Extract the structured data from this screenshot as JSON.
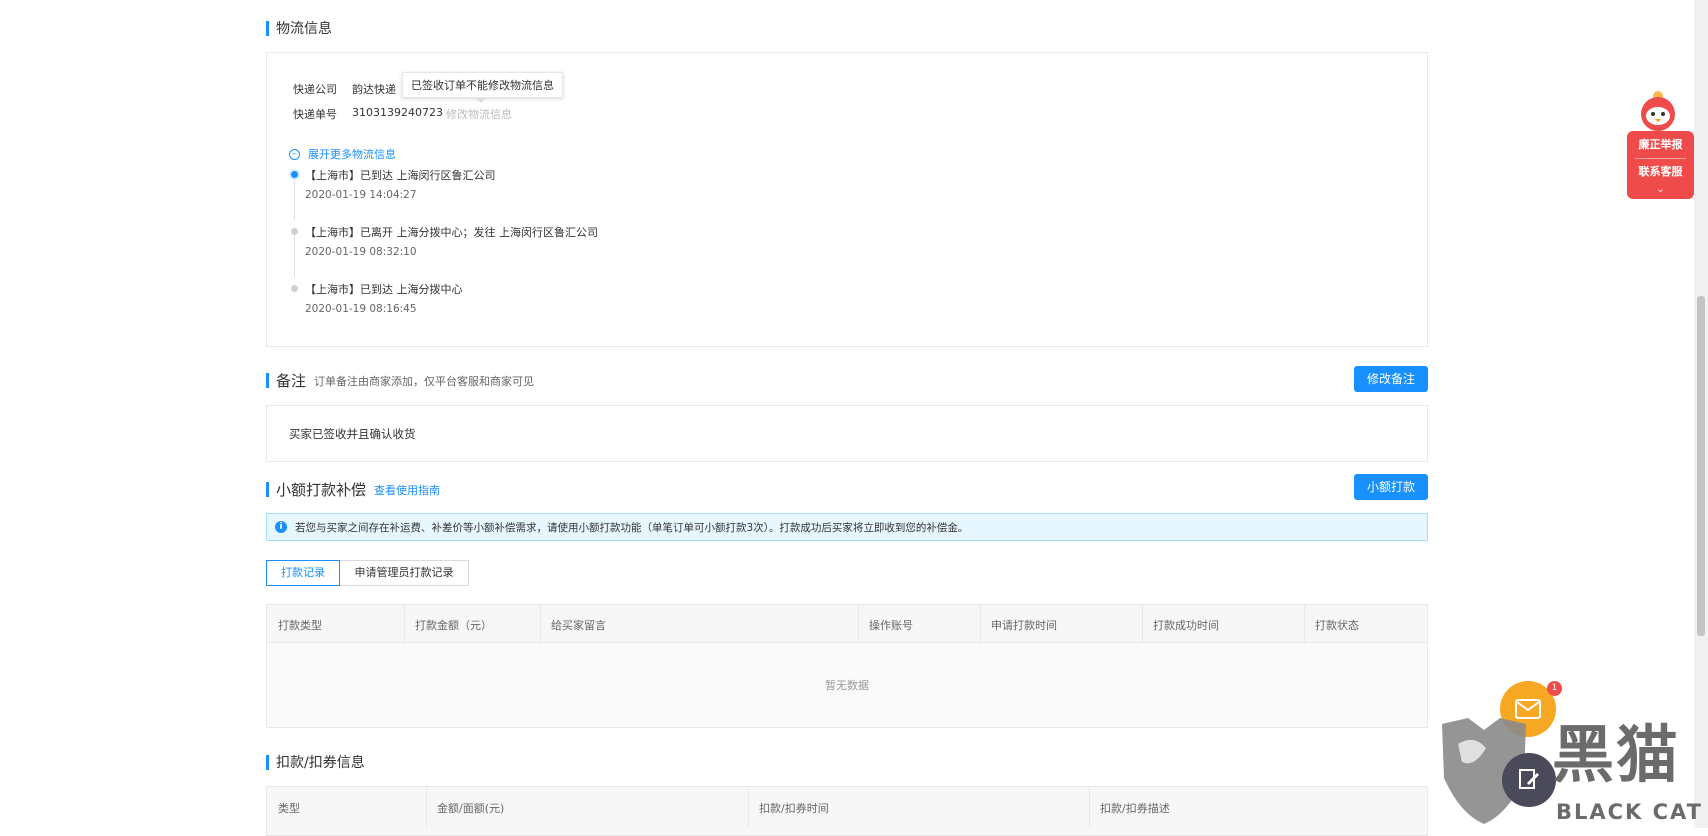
{
  "logistics": {
    "title": "物流信息",
    "company_label": "快递公司",
    "company_value": "韵达快递",
    "tooltip": "已签收订单不能修改物流信息",
    "tracking_label": "快递单号",
    "tracking_value": "3103139240723",
    "modify_link": "修改物流信息",
    "expand_link": "展开更多物流信息",
    "timeline": [
      {
        "text": "【上海市】已到达 上海闵行区鲁汇公司",
        "time": "2020-01-19 14:04:27"
      },
      {
        "text": "【上海市】已离开 上海分拨中心；发往 上海闵行区鲁汇公司",
        "time": "2020-01-19 08:32:10"
      },
      {
        "text": "【上海市】已到达 上海分拨中心",
        "time": "2020-01-19 08:16:45"
      }
    ]
  },
  "remark": {
    "title": "备注",
    "subtitle": "订单备注由商家添加，仅平台客服和商家可见",
    "edit_button": "修改备注",
    "content": "买家已签收并且确认收货"
  },
  "compensation": {
    "title": "小额打款补偿",
    "guide_link": "查看使用指南",
    "pay_button": "小额打款",
    "info": "若您与买家之间存在补运费、补差价等小额补偿需求，请使用小额打款功能（单笔订单可小额打款3次）。打款成功后买家将立即收到您的补偿金。",
    "tabs": [
      "打款记录",
      "申请管理员打款记录"
    ],
    "columns": [
      "打款类型",
      "打款金额（元）",
      "给买家留言",
      "操作账号",
      "申请打款时间",
      "打款成功时间",
      "打款状态"
    ],
    "empty": "暂无数据"
  },
  "deduction": {
    "title": "扣款/扣券信息",
    "columns": [
      "类型",
      "金额/面额(元)",
      "扣款/扣券时间",
      "扣款/扣券描述"
    ]
  },
  "side_widget": {
    "report": "廉正举报",
    "service": "联系客服",
    "accent": "#f04b4b"
  },
  "message_badge": "1",
  "watermark": {
    "cn": "黑猫",
    "en": "BLACK CAT"
  },
  "colors": {
    "primary": "#1890ff",
    "info_bg": "#e6f7ff"
  }
}
